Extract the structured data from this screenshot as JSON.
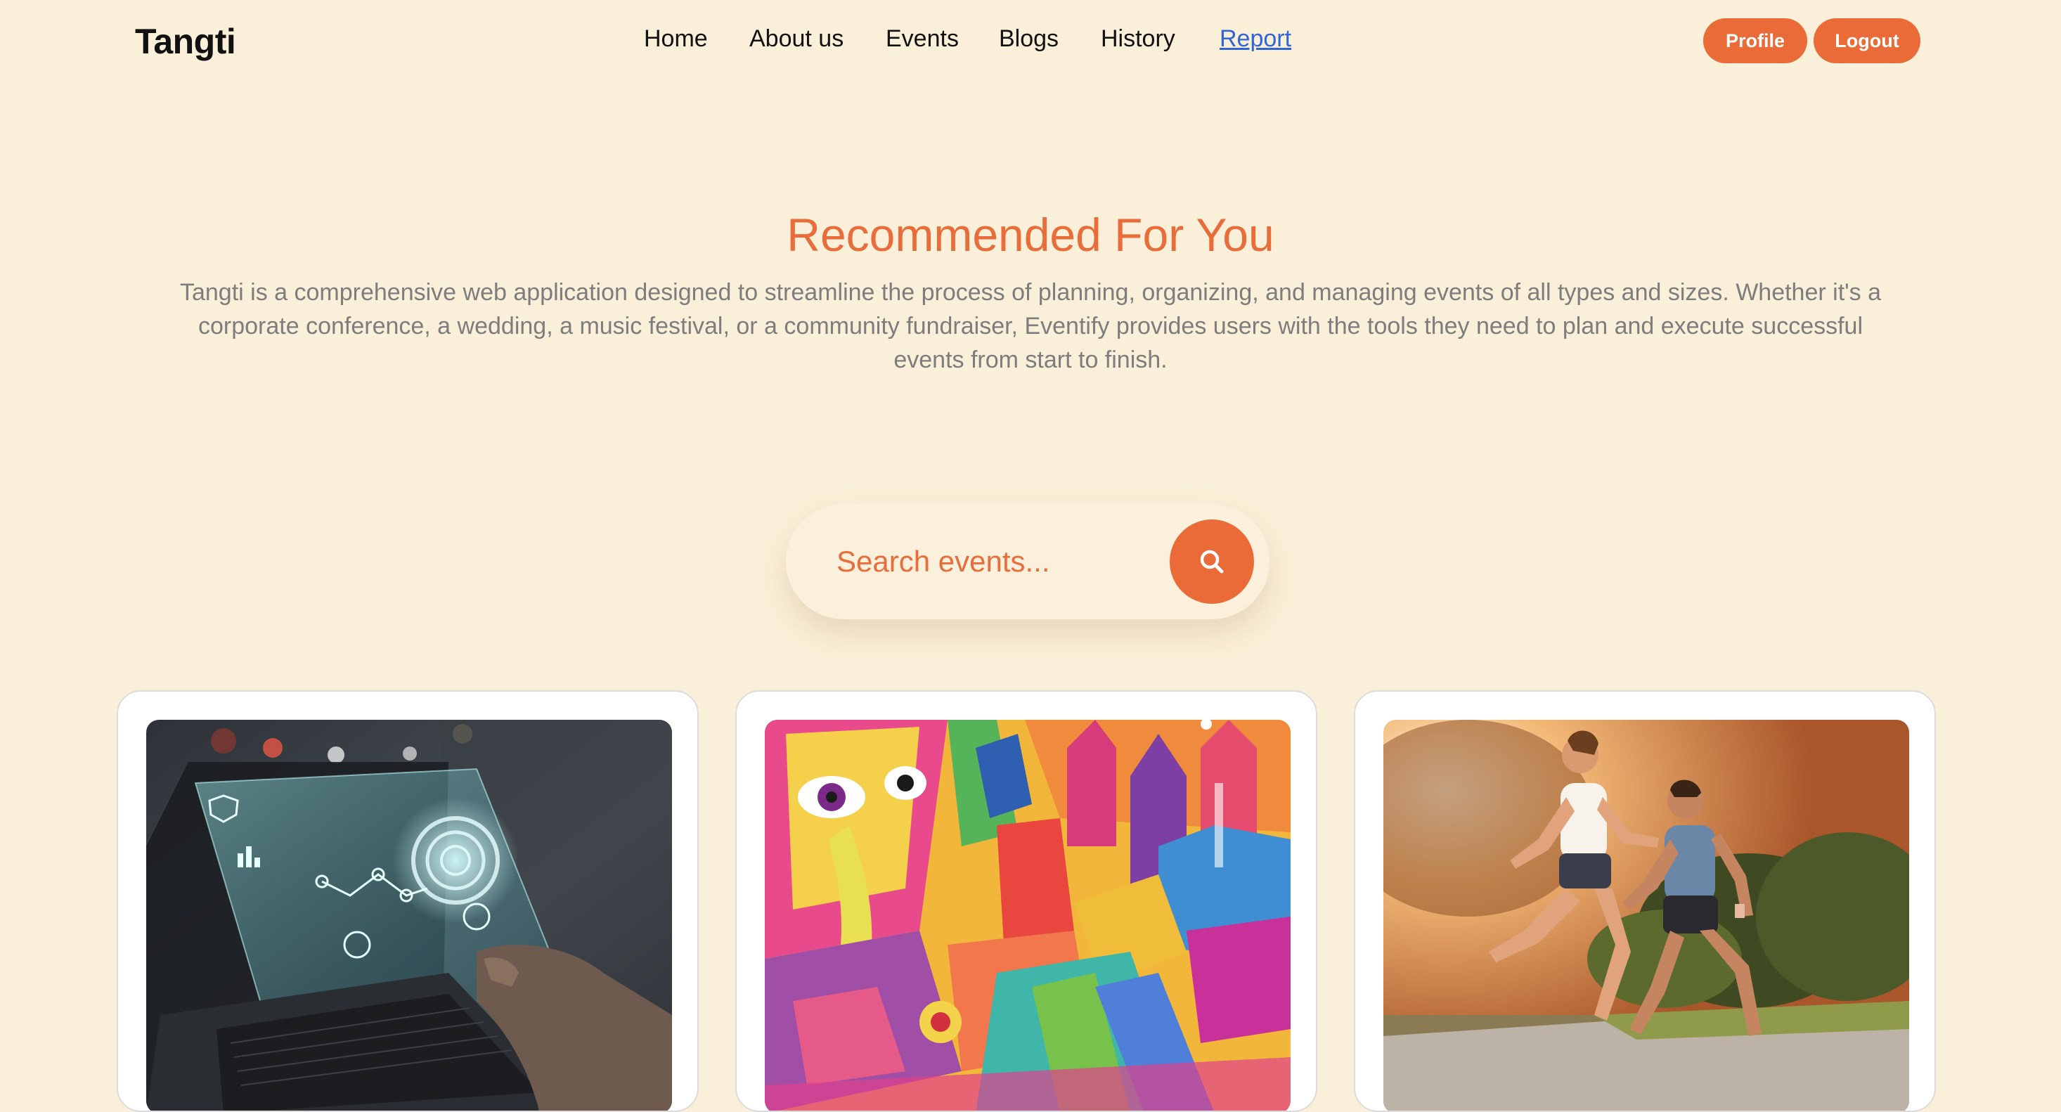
{
  "brand": "Tangti",
  "nav": {
    "items": [
      {
        "label": "Home"
      },
      {
        "label": "About us"
      },
      {
        "label": "Events"
      },
      {
        "label": "Blogs"
      },
      {
        "label": "History"
      },
      {
        "label": "Report",
        "active": true
      }
    ]
  },
  "actions": {
    "profile_label": "Profile",
    "logout_label": "Logout"
  },
  "hero": {
    "title": "Recommended For You",
    "description": "Tangti is a comprehensive web application designed to streamline the process of planning, organizing, and managing events of all types and sizes. Whether it's a corporate conference, a wedding, a music festival, or a community fundraiser, Eventify provides users with the tools they need to plan and execute successful events from start to finish."
  },
  "search": {
    "placeholder": "Search events...",
    "icon": "search-icon"
  },
  "cards": [
    {
      "image": "laptop-technology-photo"
    },
    {
      "image": "colorful-indian-art-photo"
    },
    {
      "image": "runners-park-photo"
    }
  ],
  "colors": {
    "background": "#faefd8",
    "accent": "#ea6b37",
    "title": "#e96d3a",
    "body_text": "#7d7d7d",
    "active_link": "#2f66d4"
  }
}
